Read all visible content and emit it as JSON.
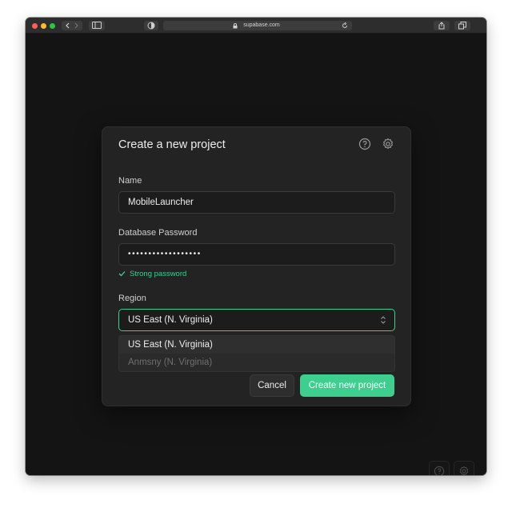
{
  "browser": {
    "url": "supabase.com"
  },
  "modal": {
    "title": "Create a new project",
    "header_icons": [
      "help-circle-icon",
      "gear-icon"
    ],
    "name": {
      "label": "Name",
      "value": "MobileLauncher"
    },
    "password": {
      "label": "Database Password",
      "value": "••••••••••••••••••",
      "strength": "Strong password"
    },
    "region": {
      "label": "Region",
      "selected": "US East (N. Virginia)",
      "options": [
        "US East (N. Virginia)",
        "Anmsny (N. Virginia)"
      ]
    },
    "buttons": {
      "cancel": "Cancel",
      "create": "Create new project"
    }
  },
  "footer_icons": [
    "help-circle-icon",
    "gear-icon"
  ],
  "colors": {
    "accent": "#3ecf8e",
    "background": "#141414",
    "modal": "#232323"
  }
}
